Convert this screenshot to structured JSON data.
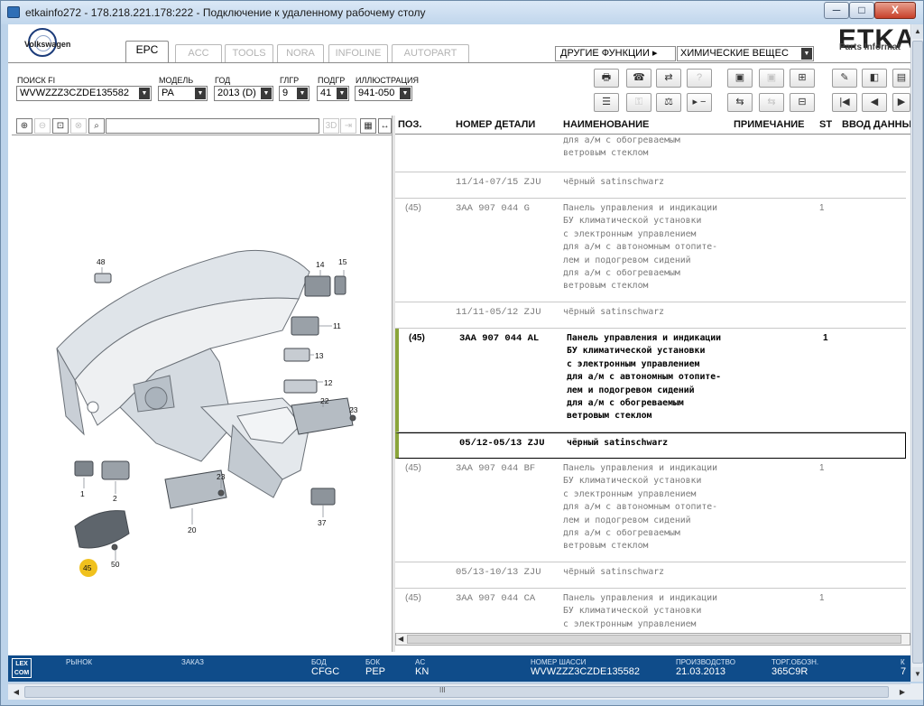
{
  "window": {
    "title": "etkainfo272 - 178.218.221.178:222 - Подключение к удаленному рабочему столу",
    "min": "─",
    "max": "□",
    "close": "X"
  },
  "brand": {
    "vw": "Volkswagen",
    "etka": "ETKA",
    "etka_sub": "Parts Informat"
  },
  "tabs": [
    {
      "label": "EPC",
      "active": true
    },
    {
      "label": "ACC"
    },
    {
      "label": "TOOLS"
    },
    {
      "label": "NORA"
    },
    {
      "label": "INFOLINE"
    },
    {
      "label": "AUTOPART"
    }
  ],
  "top_menu": {
    "other_functions": "ДРУГИЕ ФУНКЦИИ ▸",
    "chemicals": "ХИМИЧЕСКИЕ ВЕЩЕС"
  },
  "filters": {
    "fi_label": "ПОИСК FI",
    "fi_value": "WVWZZZ3CZDE135582",
    "model_label": "МОДЕЛЬ",
    "model_value": "PA",
    "year_label": "ГОД",
    "year_value": "2013 (D)",
    "main_group_label": "ГЛГР",
    "main_group_value": "9",
    "sub_group_label": "ПОДГР",
    "sub_group_value": "41",
    "illustration_label": "ИЛЛЮСТРАЦИЯ",
    "illustration_value": "941-050"
  },
  "diagram_toolbar": {
    "btn_3d": "3D"
  },
  "diagram": {
    "labels": [
      "48",
      "14",
      "15",
      "11",
      "13",
      "12",
      "22",
      "23",
      "1",
      "2",
      "23",
      "20",
      "37",
      "45",
      "50"
    ]
  },
  "table": {
    "headers": [
      "ПОЗ.",
      "НОМЕР ДЕТАЛИ",
      "НАИМЕНОВАНИЕ",
      "ПРИМЕЧАНИЕ",
      "ST",
      "ВВОД ДАННЫ"
    ],
    "rows": [
      {
        "pos": "",
        "part": "",
        "name": "для а/м с обогреваемым\nветровым стеклом",
        "st": ""
      },
      {
        "pos": "",
        "part": "11/14-07/15 ZJU",
        "name": "чёрный satinschwarz",
        "st": ""
      },
      {
        "pos": "(45)",
        "part": "3AA 907 044 G",
        "name": "Панель управления и индикации\nБУ климатической установки\nс электронным управлением\nдля а/м с автономным отопите-\nлем и подогревом сидений\nдля а/м с обогреваемым\nветровым стеклом",
        "st": "1"
      },
      {
        "pos": "",
        "part": "11/11-05/12 ZJU",
        "name": "чёрный satinschwarz",
        "st": ""
      },
      {
        "pos": "(45)",
        "part": "3AA 907 044 AL",
        "name": "Панель управления и индикации\nБУ климатической установки\nс электронным управлением\nдля а/м с автономным отопите-\nлем и подогревом сидений\nдля а/м с обогреваемым\nветровым стеклом",
        "st": "1"
      },
      {
        "pos": "",
        "part": "05/12-05/13 ZJU",
        "name": "чёрный satinschwarz",
        "st": ""
      },
      {
        "pos": "(45)",
        "part": "3AA 907 044 BF",
        "name": "Панель управления и индикации\nБУ климатической установки\nс электронным управлением\nдля а/м с автономным отопите-\nлем и подогревом сидений\nдля а/м с обогреваемым\nветровым стеклом",
        "st": "1"
      },
      {
        "pos": "",
        "part": "05/13-10/13 ZJU",
        "name": "чёрный satinschwarz",
        "st": ""
      },
      {
        "pos": "(45)",
        "part": "3AA 907 044 CA",
        "name": "Панель управления и индикации\nБУ климатической установки\nс электронным управлением",
        "st": "1"
      }
    ]
  },
  "status": {
    "lexcom": "LEX\nCOM",
    "market_label": "РЫНОК",
    "order_label": "ЗАКАЗ",
    "bod_label": "БОД",
    "bod_value": "CFGC",
    "bok_label": "БОК",
    "bok_value": "PEP",
    "ac_label": "AC",
    "ac_value": "KN",
    "chassis_label": "НОМЕР ШАССИ",
    "chassis_value": "WVWZZZ3CZDE135582",
    "prod_label": "ПРОИЗВОДСТВО",
    "prod_value": "21.03.2013",
    "trade_label": "ТОРГ.ОБОЗН.",
    "trade_value": "365C9R",
    "extra_label": "К",
    "extra_value": "7"
  },
  "scroll": {
    "grip": "III"
  }
}
